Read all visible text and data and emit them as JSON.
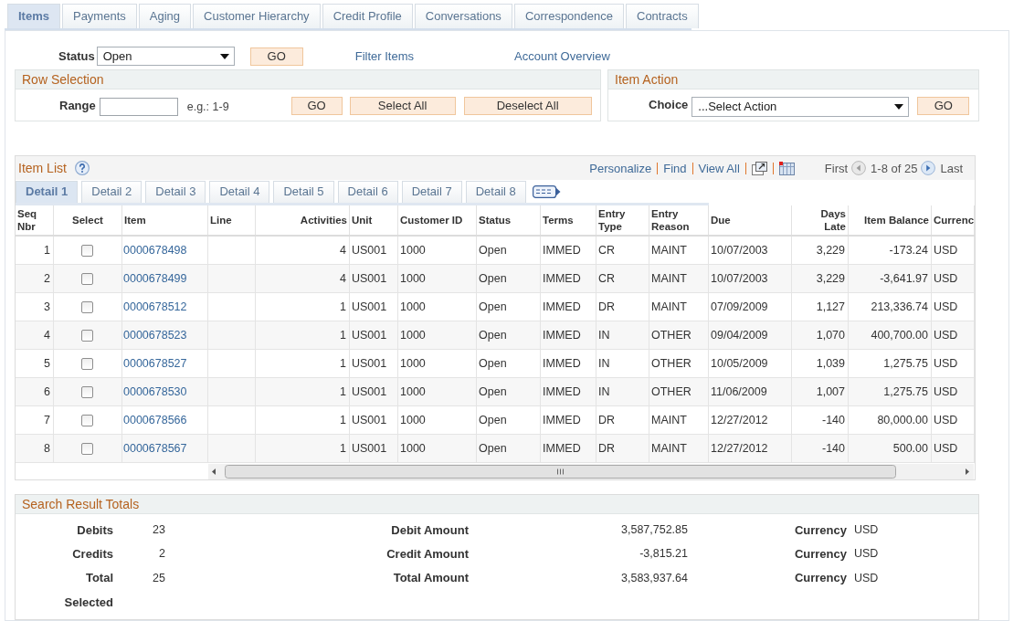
{
  "tabs": [
    {
      "label": "Items",
      "selected": true
    },
    {
      "label": "Payments",
      "selected": false
    },
    {
      "label": "Aging",
      "selected": false
    },
    {
      "label": "Customer Hierarchy",
      "selected": false
    },
    {
      "label": "Credit Profile",
      "selected": false
    },
    {
      "label": "Conversations",
      "selected": false
    },
    {
      "label": "Correspondence",
      "selected": false
    },
    {
      "label": "Contracts",
      "selected": false
    }
  ],
  "filter": {
    "status_label": "Status",
    "status_value": "Open",
    "go_button": "GO",
    "links": [
      "Filter Items",
      "Account Overview"
    ]
  },
  "row_selection": {
    "title": "Row Selection",
    "range_label": "Range",
    "range_hint": "e.g.: 1-9",
    "buttons": [
      "GO",
      "Select All",
      "Deselect All"
    ]
  },
  "item_action": {
    "title": "Item Action",
    "choice_label": "Choice",
    "choice_value": "...Select Action",
    "go_button": "GO"
  },
  "item_list": {
    "title": "Item List",
    "links": [
      "Personalize",
      "Find",
      "View All"
    ],
    "pager": {
      "first": "First",
      "prev_disabled": true,
      "range": "1-8 of 25",
      "next_disabled": false,
      "last": "Last"
    },
    "detail_tabs": [
      {
        "label": "Detail 1",
        "selected": true
      },
      {
        "label": "Detail 2",
        "selected": false
      },
      {
        "label": "Detail 3",
        "selected": false
      },
      {
        "label": "Detail 4",
        "selected": false
      },
      {
        "label": "Detail 5",
        "selected": false
      },
      {
        "label": "Detail 6",
        "selected": false
      },
      {
        "label": "Detail 7",
        "selected": false
      },
      {
        "label": "Detail 8",
        "selected": false
      }
    ],
    "columns": [
      {
        "label": "Seq Nbr",
        "kind": "num"
      },
      {
        "label": "Select",
        "kind": "check"
      },
      {
        "label": "Item",
        "kind": "link"
      },
      {
        "label": "Line",
        "kind": "text"
      },
      {
        "label": "Activities",
        "kind": "num"
      },
      {
        "label": "Unit",
        "kind": "text"
      },
      {
        "label": "Customer ID",
        "kind": "text"
      },
      {
        "label": "Status",
        "kind": "text"
      },
      {
        "label": "Terms",
        "kind": "text"
      },
      {
        "label": "Entry Type",
        "kind": "text"
      },
      {
        "label": "Entry Reason",
        "kind": "text"
      },
      {
        "label": "Due",
        "kind": "text"
      },
      {
        "label": "Days Late",
        "kind": "num"
      },
      {
        "label": "Item Balance",
        "kind": "num"
      },
      {
        "label": "Currenc",
        "kind": "text"
      }
    ],
    "rows": [
      {
        "checked": false,
        "cells": [
          "1",
          "",
          "0000678498",
          "",
          "4",
          "US001",
          "1000",
          "Open",
          "IMMED",
          "CR",
          "MAINT",
          "10/07/2003",
          "3,229",
          "-173.24",
          "USD"
        ]
      },
      {
        "checked": false,
        "cells": [
          "2",
          "",
          "0000678499",
          "",
          "4",
          "US001",
          "1000",
          "Open",
          "IMMED",
          "CR",
          "MAINT",
          "10/07/2003",
          "3,229",
          "-3,641.97",
          "USD"
        ]
      },
      {
        "checked": false,
        "cells": [
          "3",
          "",
          "0000678512",
          "",
          "1",
          "US001",
          "1000",
          "Open",
          "IMMED",
          "DR",
          "MAINT",
          "07/09/2009",
          "1,127",
          "213,336.74",
          "USD"
        ]
      },
      {
        "checked": false,
        "cells": [
          "4",
          "",
          "0000678523",
          "",
          "1",
          "US001",
          "1000",
          "Open",
          "IMMED",
          "IN",
          "OTHER",
          "09/04/2009",
          "1,070",
          "400,700.00",
          "USD"
        ]
      },
      {
        "checked": false,
        "cells": [
          "5",
          "",
          "0000678527",
          "",
          "1",
          "US001",
          "1000",
          "Open",
          "IMMED",
          "IN",
          "OTHER",
          "10/05/2009",
          "1,039",
          "1,275.75",
          "USD"
        ]
      },
      {
        "checked": false,
        "cells": [
          "6",
          "",
          "0000678530",
          "",
          "1",
          "US001",
          "1000",
          "Open",
          "IMMED",
          "IN",
          "OTHER",
          "11/06/2009",
          "1,007",
          "1,275.75",
          "USD"
        ]
      },
      {
        "checked": false,
        "cells": [
          "7",
          "",
          "0000678566",
          "",
          "1",
          "US001",
          "1000",
          "Open",
          "IMMED",
          "DR",
          "MAINT",
          "12/27/2012",
          "-140",
          "80,000.00",
          "USD"
        ]
      },
      {
        "checked": false,
        "cells": [
          "8",
          "",
          "0000678567",
          "",
          "1",
          "US001",
          "1000",
          "Open",
          "IMMED",
          "DR",
          "MAINT",
          "12/27/2012",
          "-140",
          "500.00",
          "USD"
        ]
      }
    ]
  },
  "totals": {
    "title": "Search Result Totals",
    "rows": [
      {
        "label": "Debits",
        "count": "23",
        "amount_label": "Debit Amount",
        "amount": "3,587,752.85",
        "currency_label": "Currency",
        "currency": "USD"
      },
      {
        "label": "Credits",
        "count": "2",
        "amount_label": "Credit Amount",
        "amount": "-3,815.21",
        "currency_label": "Currency",
        "currency": "USD"
      },
      {
        "label": "Total",
        "count": "25",
        "amount_label": "Total Amount",
        "amount": "3,583,937.64",
        "currency_label": "Currency",
        "currency": "USD"
      },
      {
        "label": "Selected"
      }
    ]
  }
}
